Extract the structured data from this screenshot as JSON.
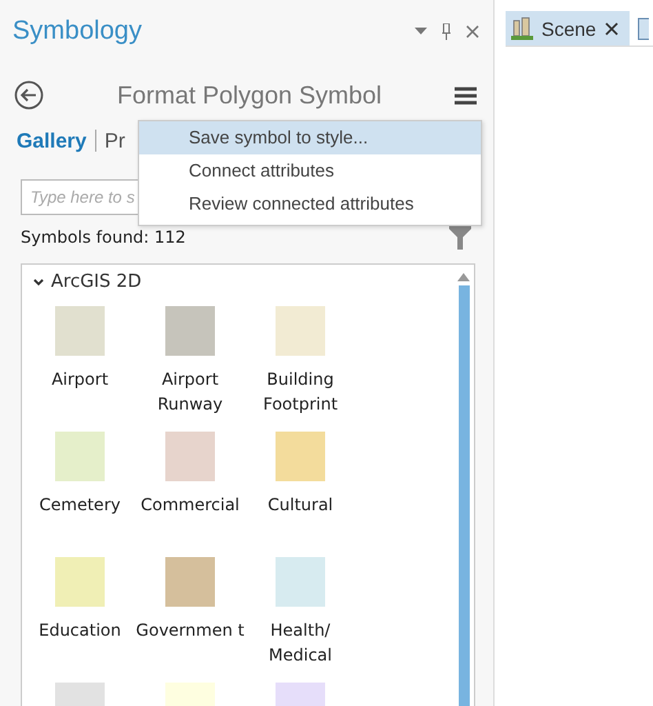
{
  "pane": {
    "title": "Symbology",
    "subtitle": "Format Polygon Symbol"
  },
  "tabs": [
    {
      "label": "Gallery",
      "selected": true
    },
    {
      "label": "Pr",
      "selected": false
    }
  ],
  "menu": [
    {
      "label": "Save symbol to style...",
      "selected": true
    },
    {
      "label": "Connect attributes",
      "selected": false
    },
    {
      "label": "Review connected attributes",
      "selected": false
    }
  ],
  "search": {
    "placeholder": "Type here to s"
  },
  "count": "Symbols found: 112",
  "gallery": {
    "group": "ArcGIS 2D",
    "expanded": true,
    "symbols": [
      {
        "label": "Airport",
        "color": "#e1e0cf"
      },
      {
        "label": "Airport Runway",
        "color": "#c6c4bb"
      },
      {
        "label": "Building Footprint",
        "color": "#f2ebd3"
      },
      {
        "label": "Cemetery",
        "color": "#e5efca"
      },
      {
        "label": "Commercial",
        "color": "#e7d4cc"
      },
      {
        "label": "Cultural",
        "color": "#f3dc9c"
      },
      {
        "label": "Education",
        "color": "#f0efb5"
      },
      {
        "label": "Governmen t",
        "color": "#d5bf9c"
      },
      {
        "label": "Health/ Medical",
        "color": "#d7ebf0"
      },
      {
        "color": "#e2e2e2"
      },
      {
        "color": "#fefee0"
      },
      {
        "color": "#e6defa"
      }
    ]
  },
  "doc_tabs": [
    {
      "label": "Scene",
      "selected": true
    }
  ]
}
